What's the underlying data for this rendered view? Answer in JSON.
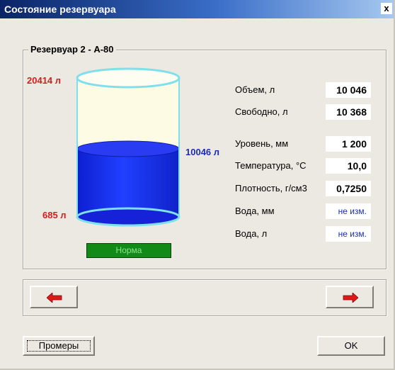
{
  "window": {
    "title": "Состояние резервуара",
    "close_glyph": "x"
  },
  "tank": {
    "title": "Резервуар 2 - А-80",
    "max_volume_label": "20414 л",
    "current_volume_label": "10046 л",
    "min_volume_label": "685 л",
    "fill_level": 0.49,
    "status": "Норма",
    "colors": {
      "empty_space": "#fdfbe4",
      "liquid": "#1a2ff0",
      "rim": "#7fe0ec",
      "max_label": "#d61d1d",
      "current_label": "#1c2cb8",
      "status_bg": "#118a18"
    }
  },
  "params": [
    {
      "label": "Объем, л",
      "value": "10 046"
    },
    {
      "label": "Свободно, л",
      "value": "10 368"
    },
    {
      "label": "Уровень, мм",
      "value": "1 200"
    },
    {
      "label": "Температура, °С",
      "value": "10,0"
    },
    {
      "label": "Плотность, г/см3",
      "value": "0,7250"
    },
    {
      "label": "Вода, мм",
      "value": "не изм."
    },
    {
      "label": "Вода, л",
      "value": "не изм."
    }
  ],
  "nav": {
    "prev_icon": "arrow-left-icon",
    "next_icon": "arrow-right-icon"
  },
  "buttons": {
    "measurements": "Промеры",
    "ok": "OK"
  }
}
